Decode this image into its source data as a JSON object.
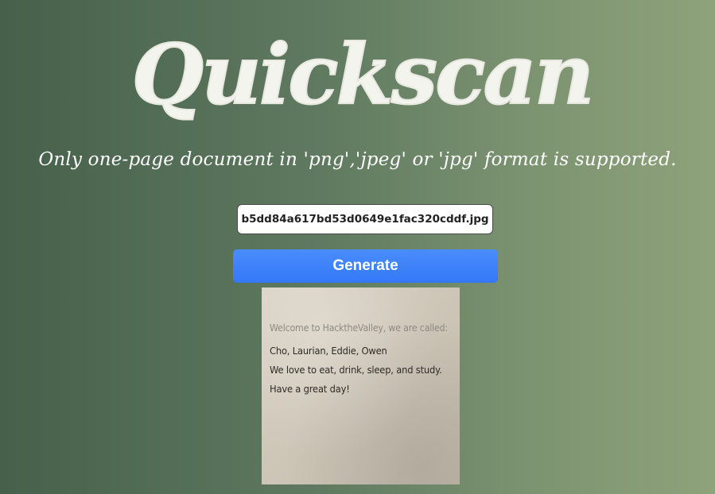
{
  "header": {
    "logo_text": "Quickscan",
    "subtitle": "Only one-page document in 'png','jpeg' or 'jpg' format is supported."
  },
  "upload": {
    "file_name": "b5dd84a617bd53d0649e1fac320cddf.jpg",
    "generate_label": "Generate"
  },
  "preview": {
    "lines": [
      "Welcome to HacktheValley, we are called:",
      "Cho, Laurian, Eddie, Owen",
      "We love to eat, drink, sleep, and study.",
      "Have a great day!"
    ]
  },
  "colors": {
    "background_start": "#46604b",
    "background_end": "#8ea27b",
    "button": "#3478f6",
    "logo": "#f4f4ef"
  }
}
